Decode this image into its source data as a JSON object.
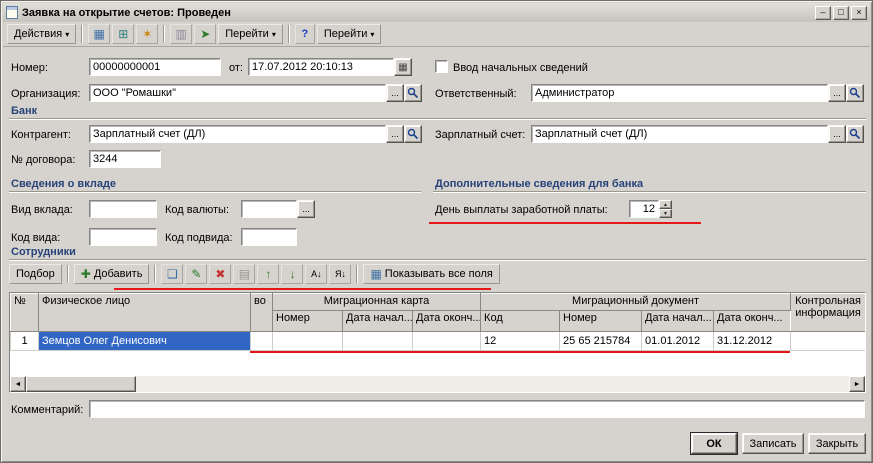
{
  "window": {
    "title": "Заявка на открытие счетов: Проведен",
    "minimize_glyph": "–",
    "maximize_glyph": "□",
    "close_glyph": "×"
  },
  "main_toolbar": {
    "actions_label": "Действия",
    "go_label": "Перейти",
    "go2_label": "Перейти",
    "help_glyph": "?"
  },
  "icons": {
    "dropdown_glyph": "▾",
    "ellipsis_glyph": "...",
    "calendar_glyph": "▦",
    "add_glyph": "✚",
    "add_copy_glyph": "❏",
    "edit_glyph": "✎",
    "delete_glyph": "✖",
    "list_glyph": "▤",
    "move_up_glyph": "↑",
    "move_down_glyph": "↓",
    "sort_asc_glyph": "А↓",
    "sort_desc_glyph": "Я↓",
    "grid_glyph": "▦",
    "scroll_left_glyph": "◄",
    "scroll_right_glyph": "►",
    "spin_up_glyph": "▲",
    "spin_down_glyph": "▼",
    "toolbar_icon1_glyph": "▦",
    "toolbar_icon2_glyph": "⊞",
    "toolbar_icon3_glyph": "✶",
    "toolbar_icon4_glyph": "▥",
    "toolbar_icon5_glyph": "➤"
  },
  "header_fields": {
    "number_label": "Номер:",
    "number_value": "00000000001",
    "date_label": "от:",
    "date_value": "17.07.2012 20:10:13",
    "initial_info_label": "Ввод начальных сведений",
    "initial_info_checked": false,
    "organization_label": "Организация:",
    "organization_value": "ООО \"Ромашки\"",
    "responsible_label": "Ответственный:",
    "responsible_value": "Администратор"
  },
  "bank_section": {
    "title": "Банк",
    "counterparty_label": "Контрагент:",
    "counterparty_value": "Зарплатный счет (ДЛ)",
    "salary_account_label": "Зарплатный счет:",
    "salary_account_value": "Зарплатный счет (ДЛ)",
    "contract_number_label": "№ договора:",
    "contract_number_value": "3244"
  },
  "deposit_section": {
    "title": "Сведения о вкладе",
    "deposit_kind_label": "Вид вклада:",
    "deposit_kind_value": "",
    "currency_code_label": "Код валюты:",
    "currency_code_value": "",
    "kind_code_label": "Код вида:",
    "kind_code_value": "",
    "subkind_code_label": "Код подвида:",
    "subkind_code_value": ""
  },
  "bank_extra_section": {
    "title": "Дополнительные сведения для банка",
    "salary_day_label": "День выплаты заработной платы:",
    "salary_day_value": "12"
  },
  "employees_section": {
    "title": "Сотрудники",
    "toolbar": {
      "pick_label": "Подбор",
      "add_label": "Добавить",
      "show_all_fields_label": "Показывать все поля"
    },
    "table": {
      "headers": {
        "row_number": "№",
        "person": "Физическое лицо",
        "clipped": "во",
        "migration_card_group": "Миграционная карта",
        "migration_card_number": "Номер",
        "migration_card_date_start": "Дата начал...",
        "migration_card_date_end": "Дата оконч...",
        "migration_doc_group": "Миграционный документ",
        "migration_doc_code": "Код",
        "migration_doc_number": "Номер",
        "migration_doc_date_start": "Дата начал...",
        "migration_doc_date_end": "Дата оконч...",
        "control_info": "Контрольная информация"
      },
      "rows": [
        {
          "row_number": "1",
          "person": "Земцов Олег Денисович",
          "clipped": "",
          "migration_card_number": "",
          "migration_card_date_start": "",
          "migration_card_date_end": "",
          "migration_doc_code": "12",
          "migration_doc_number": "25 65 215784",
          "migration_doc_date_start": "01.01.2012",
          "migration_doc_date_end": "31.12.2012",
          "control_info": ""
        }
      ]
    }
  },
  "comment": {
    "label": "Комментарий:",
    "value": ""
  },
  "footer": {
    "ok_label": "ОК",
    "save_label": "Записать",
    "close_label": "Закрыть"
  },
  "colors": {
    "selection_bg": "#3166c5",
    "annotation_red": "#e51717",
    "section_title": "#28437a"
  }
}
